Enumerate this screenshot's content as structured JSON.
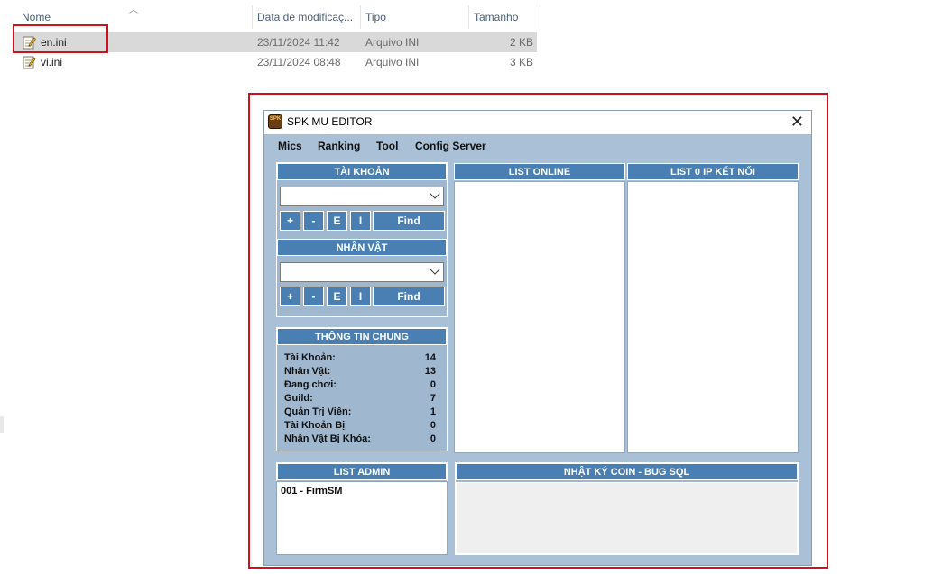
{
  "explorer": {
    "columns": {
      "name": "Nome",
      "date": "Data de modificaç...",
      "type": "Tipo",
      "size": "Tamanho"
    },
    "files": [
      {
        "name": "en.ini",
        "date": "23/11/2024 11:42",
        "type": "Arquivo INI",
        "size": "2 KB",
        "selected": true
      },
      {
        "name": "vi.ini",
        "date": "23/11/2024 08:48",
        "type": "Arquivo INI",
        "size": "3 KB",
        "selected": false
      }
    ],
    "highlight_color": "#d0111b"
  },
  "app": {
    "logo_text": "SPK",
    "title": "SPK MU EDITOR",
    "close_glyph": "✕",
    "menu": [
      "Mics",
      "Ranking",
      "Tool",
      "Config Server"
    ],
    "account": {
      "header": "TÀI KHOẢN",
      "buttons": [
        "+",
        "-",
        "E",
        "I",
        "Find"
      ]
    },
    "character": {
      "header": "NHÂN VẬT",
      "buttons": [
        "+",
        "-",
        "E",
        "I",
        "Find"
      ]
    },
    "info": {
      "header": "THÔNG TIN CHUNG",
      "stats": [
        {
          "label": "Tài Khoản:",
          "value": "14"
        },
        {
          "label": "Nhân Vật:",
          "value": "13"
        },
        {
          "label": "Đang chơi:",
          "value": "0"
        },
        {
          "label": "Guild:",
          "value": "7"
        },
        {
          "label": "Quản Trị Viên:",
          "value": "1"
        },
        {
          "label": "Tài Khoản Bị",
          "value": "0"
        },
        {
          "label": "Nhân Vật Bị Khóa:",
          "value": "0"
        }
      ]
    },
    "list_online": {
      "header": "LIST ONLINE"
    },
    "list_ip": {
      "header": "LIST 0 IP KẾT NỐI"
    },
    "list_admin": {
      "header": "LIST ADMIN",
      "items": [
        "001 - FirmSM"
      ]
    },
    "log": {
      "header": "NHẬT KÝ COIN - BUG SQL"
    },
    "colors": {
      "header_bg": "#4a7fb4",
      "window_bg": "#aac0d7"
    }
  }
}
